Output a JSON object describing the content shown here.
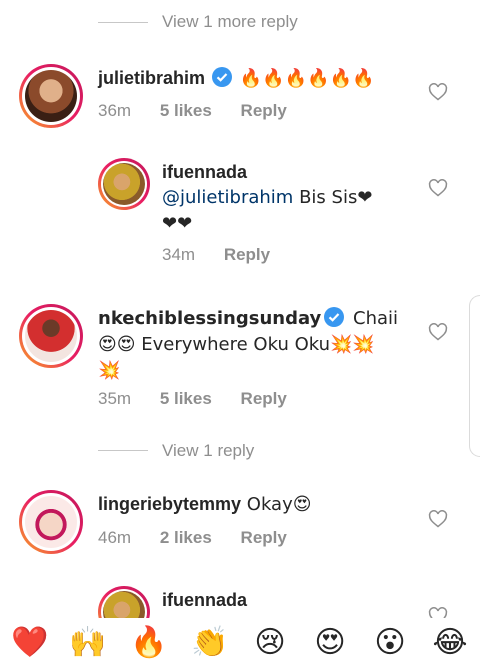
{
  "view_more_1": "View 1 more reply",
  "view_more_2": "View 1 reply",
  "comments": [
    {
      "username": "julietibrahim",
      "verified": true,
      "text": "🔥🔥🔥🔥🔥🔥",
      "time": "36m",
      "likes": "5 likes",
      "reply": "Reply"
    },
    {
      "username": "ifuennada",
      "mention": "@julietibrahim",
      "text": " Bis Sis❤",
      "text2": "❤❤",
      "time": "34m",
      "reply": "Reply"
    },
    {
      "username": "nkechiblessingsunday",
      "verified": true,
      "text": " Chaii",
      "text2": "😍😍 Everywhere Oku Oku💥💥",
      "text3": "💥",
      "time": "35m",
      "likes": "5 likes",
      "reply": "Reply"
    },
    {
      "username": "lingeriebytemmy",
      "text": " Okay😍",
      "time": "46m",
      "likes": "2 likes",
      "reply": "Reply"
    },
    {
      "username": "ifuennada"
    }
  ],
  "reactions": [
    "❤️",
    "🙌",
    "🔥",
    "👏",
    "😢",
    "😍",
    "😮",
    "😂"
  ],
  "colors": {
    "link": "#003569",
    "muted": "#8e8e8e",
    "verified": "#3897f0",
    "heart": "#ed4956"
  }
}
